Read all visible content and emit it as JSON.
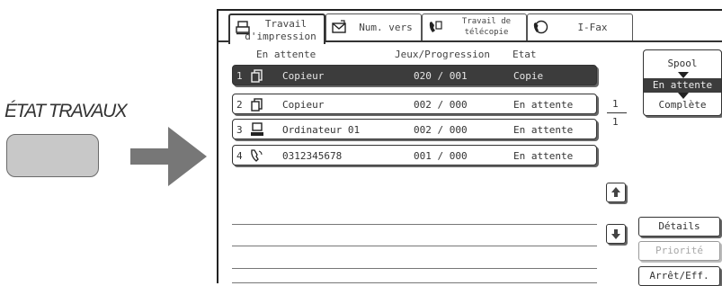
{
  "instruction": {
    "key_label": "ÉTAT TRAVAUX"
  },
  "tabs": [
    {
      "line1": "Travail",
      "line2": "d'impression",
      "icon": "printer-icon",
      "active": true
    },
    {
      "line1": "Num. vers",
      "line2": "",
      "icon": "scan-send-icon",
      "active": false
    },
    {
      "line1": "Travail de",
      "line2": "télécopie",
      "icon": "fax-icon",
      "active": false
    },
    {
      "line1": "I-Fax",
      "line2": "",
      "icon": "internet-fax-icon",
      "active": false
    }
  ],
  "columns": {
    "waiting": "En attente",
    "sets": "Jeux/Progression",
    "state": "Etat"
  },
  "jobs": [
    {
      "num": "1",
      "icon": "copier-icon",
      "name": "Copieur",
      "progress": "020 / 001",
      "state": "Copie"
    },
    {
      "num": "2",
      "icon": "copier-icon",
      "name": "Copieur",
      "progress": "002 / 000",
      "state": "En attente"
    },
    {
      "num": "3",
      "icon": "computer-icon",
      "name": "Ordinateur 01",
      "progress": "002 / 000",
      "state": "En attente"
    },
    {
      "num": "4",
      "icon": "phone-fax-icon",
      "name": "0312345678",
      "progress": "001 / 000",
      "state": "En attente"
    }
  ],
  "spool": {
    "spool": "Spool",
    "waiting": "En attente",
    "complete": "Complète"
  },
  "page": {
    "current": "1",
    "total": "1"
  },
  "buttons": {
    "details": "Détails",
    "priority": "Priorité",
    "stop_delete": "Arrêt/Eff."
  }
}
